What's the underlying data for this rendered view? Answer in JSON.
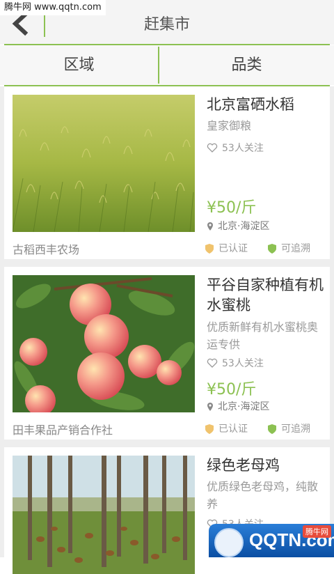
{
  "watermark_top": "腾牛网 www.qqtn.com",
  "header": {
    "title": "赶集市"
  },
  "filters": {
    "region": "区域",
    "category": "品类"
  },
  "products": [
    {
      "title": "北京富硒水稻",
      "subtitle": "皇家御粮",
      "followers": "53人关注",
      "price": "¥50/斤",
      "location": "北京·海淀区",
      "farm": "古稻西丰农场",
      "certified": "已认证",
      "traceable": "可追溯"
    },
    {
      "title": "平谷自家种植有机水蜜桃",
      "subtitle": "优质新鲜有机水蜜桃奥运专供",
      "followers": "53人关注",
      "price": "¥50/斤",
      "location": "北京·海淀区",
      "farm": "田丰果品产销合作社",
      "certified": "已认证",
      "traceable": "可追溯"
    },
    {
      "title": "绿色老母鸡",
      "subtitle": "优质绿色老母鸡，纯散养",
      "followers": "53人关注"
    }
  ],
  "bottom_watermark": {
    "text": "QQTN.com",
    "tag": "腾牛网"
  },
  "colors": {
    "accent": "#8cc152",
    "certified": "#f0c36d",
    "traceable": "#8cc152"
  }
}
